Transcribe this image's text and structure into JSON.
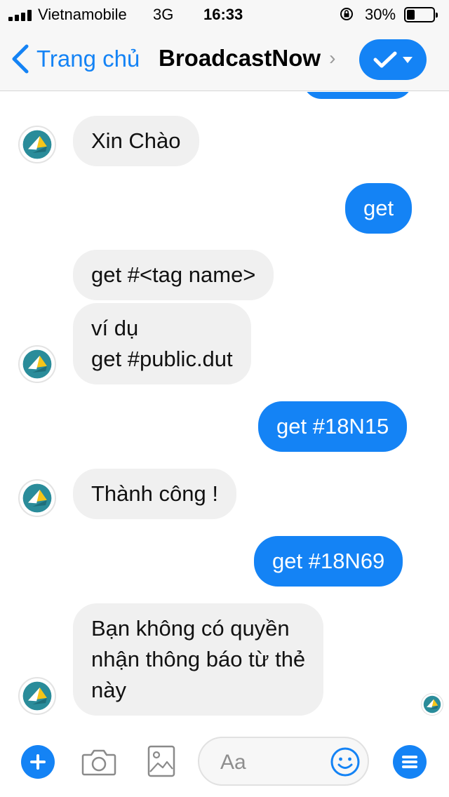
{
  "status_bar": {
    "carrier": "Vietnamobile",
    "network": "3G",
    "time": "16:33",
    "battery_percent": "30%",
    "battery_level": 0.3,
    "signal_bars": 4
  },
  "nav": {
    "back_label": "Trang chủ",
    "title": "BroadcastNow",
    "title_chevron": "›",
    "action_icon": "check-dropdown-icon"
  },
  "messages": [
    {
      "direction": "incoming",
      "text": "Xin Chào"
    },
    {
      "direction": "outgoing",
      "text": "get"
    },
    {
      "direction": "incoming",
      "text": "get #<tag name>"
    },
    {
      "direction": "incoming",
      "text": "ví dụ\nget #public.dut"
    },
    {
      "direction": "outgoing",
      "text": "get #18N15"
    },
    {
      "direction": "incoming",
      "text": "Thành công !"
    },
    {
      "direction": "outgoing",
      "text": "get #18N69"
    },
    {
      "direction": "incoming",
      "text": "Bạn không có quyền\nnhận thông báo từ thẻ\nnày"
    }
  ],
  "composer": {
    "placeholder": "Aa",
    "icons": [
      "plus-icon",
      "camera-icon",
      "image-icon",
      "emoji-icon",
      "menu-icon"
    ]
  },
  "colors": {
    "accent": "#1483f5",
    "incoming_bubble": "#f0f0f0",
    "bar_background": "#f7f7f7",
    "avatar_teal": "#2a8c9a",
    "avatar_yellow": "#f5c518"
  }
}
